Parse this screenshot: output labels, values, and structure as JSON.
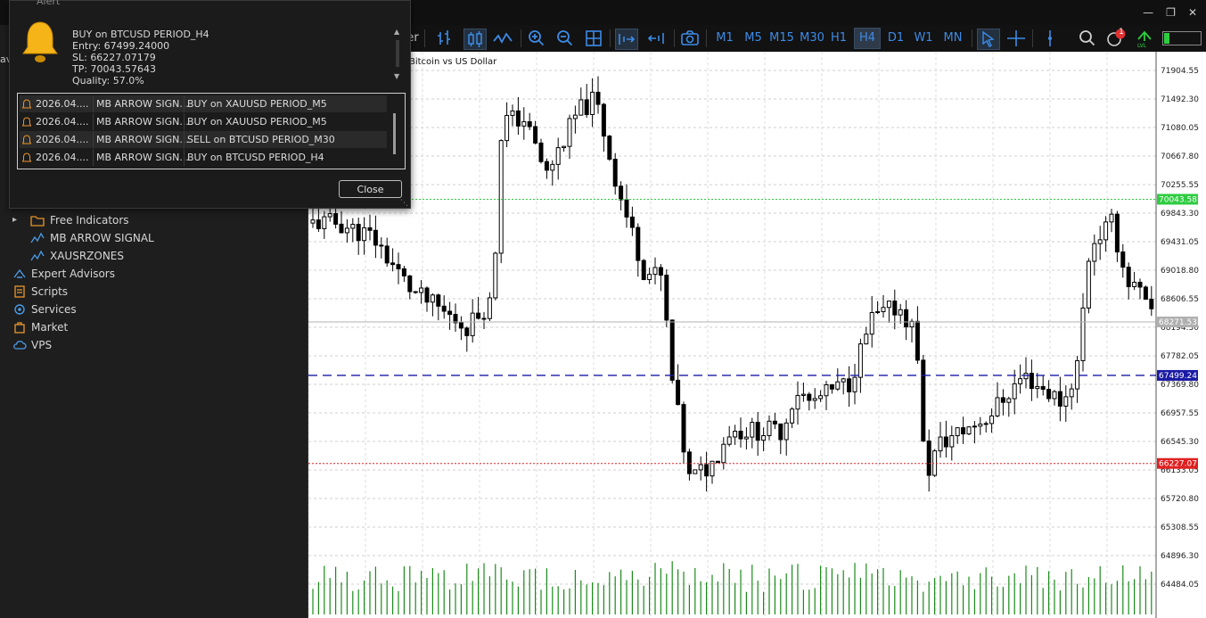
{
  "alert": {
    "title": "Alert",
    "message": [
      "BUY on BTCUSD PERIOD_H4",
      "Entry: 67499.24000",
      "SL: 66227.07179",
      "TP: 70043.57643",
      "Quality: 57.0%"
    ],
    "rows": [
      {
        "time": "2026.04....",
        "source": "MB ARROW SIGN...",
        "text": "BUY on XAUUSD PERIOD_M5"
      },
      {
        "time": "2026.04....",
        "source": "MB ARROW SIGN...",
        "text": "BUY on XAUUSD PERIOD_M5"
      },
      {
        "time": "2026.04....",
        "source": "MB ARROW SIGN...",
        "text": "SELL on BTCUSD PERIOD_M30"
      },
      {
        "time": "2026.04....",
        "source": "MB ARROW SIGN...",
        "text": "BUY on BTCUSD PERIOD_H4"
      }
    ],
    "close_label": "Close"
  },
  "toolbar": {
    "partial_label": "er",
    "timeframes": [
      "M1",
      "M5",
      "M15",
      "M30",
      "H1",
      "H4",
      "D1",
      "W1",
      "MN"
    ],
    "active_timeframe": "H4",
    "notification_count": "1"
  },
  "navigator": {
    "items": [
      {
        "label": "Free Indicators",
        "icon": "folder-icon",
        "level": 1
      },
      {
        "label": "MB ARROW SIGNAL",
        "icon": "indicator-icon",
        "level": 2
      },
      {
        "label": "XAUSRZONES",
        "icon": "indicator-icon",
        "level": 2
      },
      {
        "label": "Expert Advisors",
        "icon": "expert-advisor-icon",
        "level": 0
      },
      {
        "label": "Scripts",
        "icon": "scripts-icon",
        "level": 0
      },
      {
        "label": "Services",
        "icon": "services-icon",
        "level": 0
      },
      {
        "label": "Market",
        "icon": "market-icon",
        "level": 0
      },
      {
        "label": "VPS",
        "icon": "vps-cloud-icon",
        "level": 0
      }
    ]
  },
  "chart": {
    "symbol_description": "Bitcoin vs US Dollar",
    "price_ticks": [
      "71904.55",
      "71492.30",
      "71080.05",
      "70667.80",
      "70255.55",
      "69843.30",
      "69431.05",
      "69018.80",
      "68606.55",
      "68194.30",
      "67782.05",
      "67369.80",
      "66957.55",
      "66545.30",
      "66133.05",
      "65720.80",
      "65308.55",
      "64896.30",
      "64484.05"
    ],
    "levels": [
      {
        "name": "tp",
        "price": 70043.58,
        "label": "70043.58",
        "color": "#2ecc40"
      },
      {
        "name": "current",
        "price": 68271.53,
        "label": "68271.53",
        "color": "#b0b0b0"
      },
      {
        "name": "entry",
        "price": 67499.24,
        "label": "67499.24",
        "color": "#1a1aa6"
      },
      {
        "name": "sl",
        "price": 66227.07,
        "label": "66227.07",
        "color": "#e02020"
      }
    ],
    "colors": {
      "volume": "#1a8a1a",
      "candle": "#000000",
      "accent": "#3d8be6"
    }
  }
}
